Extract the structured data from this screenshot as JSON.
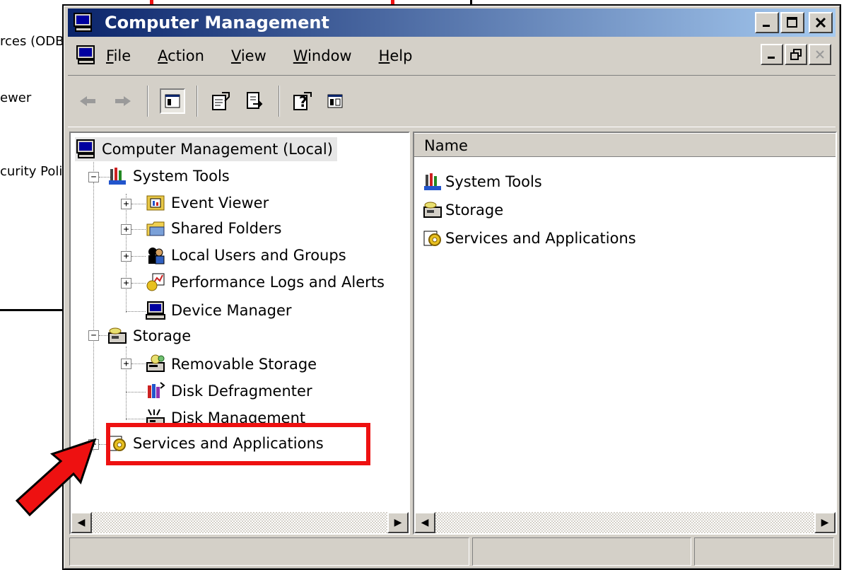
{
  "background_window": {
    "items": [
      "rces (ODB",
      "ewer",
      "curity Polic"
    ]
  },
  "window": {
    "title": "Computer Management",
    "title_buttons": [
      "minimize",
      "maximize",
      "close"
    ]
  },
  "menu": {
    "items": [
      {
        "label": "File",
        "ul": "F"
      },
      {
        "label": "Action",
        "ul": "A"
      },
      {
        "label": "View",
        "ul": "V"
      },
      {
        "label": "Window",
        "ul": "W"
      },
      {
        "label": "Help",
        "ul": "H"
      }
    ]
  },
  "toolbar": {
    "buttons": [
      "back-arrow",
      "forward-arrow",
      "show-hide-console-tree",
      "properties",
      "export-list",
      "help",
      "show-hide-action-pane"
    ]
  },
  "tree": {
    "root": "Computer Management (Local)",
    "system_tools": "System Tools",
    "event_viewer": "Event Viewer",
    "shared_folders": "Shared Folders",
    "local_users": "Local Users and Groups",
    "perf_logs": "Performance Logs and Alerts",
    "device_manager": "Device Manager",
    "storage": "Storage",
    "removable_storage": "Removable Storage",
    "disk_defrag": "Disk Defragmenter",
    "disk_mgmt": "Disk Management",
    "services_apps": "Services and Applications"
  },
  "list": {
    "column_name": "Name",
    "items": [
      "System Tools",
      "Storage",
      "Services and Applications"
    ]
  },
  "colors": {
    "title_start": "#0a246a",
    "title_end": "#a6caf0",
    "highlight": "#ee1111",
    "chrome": "#d4d0c8"
  }
}
